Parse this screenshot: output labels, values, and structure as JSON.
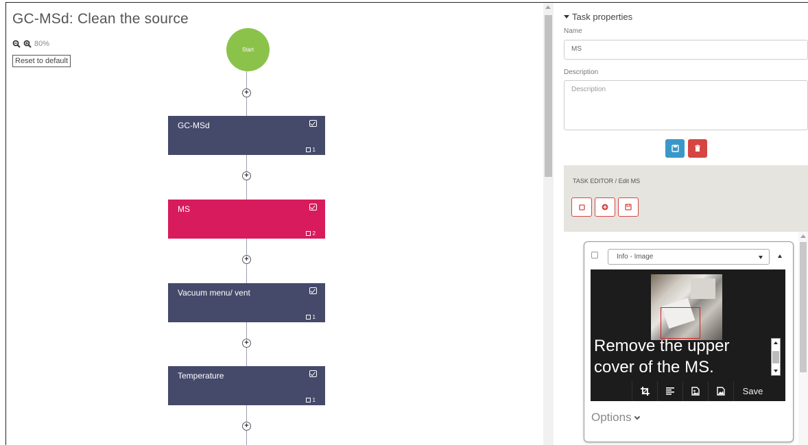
{
  "workflow": {
    "title": "GC-MSd: Clean the source",
    "zoom_level": "80%",
    "reset_label": "Reset to default",
    "start_label": "Start",
    "tasks": [
      {
        "name": "GC-MSd",
        "count": "1",
        "active": false
      },
      {
        "name": "MS",
        "count": "2",
        "active": true
      },
      {
        "name": "Vacuum menu/ vent",
        "count": "1",
        "active": false
      },
      {
        "name": "Temperature",
        "count": "1",
        "active": false
      }
    ],
    "colors": {
      "start": "#8bc34a",
      "task": "#454a6b",
      "task_active": "#d81b5c"
    }
  },
  "properties": {
    "header": "Task properties",
    "name_label": "Name",
    "name_value": "MS",
    "description_label": "Description",
    "description_placeholder": "Description",
    "save_icon": "floppy-icon",
    "delete_icon": "trash-icon"
  },
  "editor": {
    "title": "TASK EDITOR / Edit MS",
    "buttons": [
      "square-icon",
      "plus-circle-icon",
      "floppy-icon"
    ],
    "card": {
      "type_selected": "Info - Image",
      "image_text": "Remove the upper cover of the MS.",
      "toolbar": [
        "crop-icon",
        "align-left-icon",
        "image-edit-icon",
        "image-icon"
      ],
      "save_label": "Save",
      "options_label": "Options"
    }
  }
}
